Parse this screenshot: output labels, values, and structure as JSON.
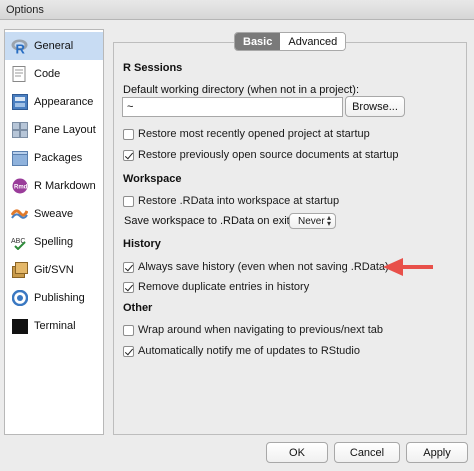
{
  "window": {
    "title": "Options"
  },
  "sidebar": {
    "items": [
      {
        "label": "General",
        "icon": "r-logo-icon",
        "selected": true
      },
      {
        "label": "Code",
        "icon": "code-icon"
      },
      {
        "label": "Appearance",
        "icon": "appearance-icon"
      },
      {
        "label": "Pane Layout",
        "icon": "pane-layout-icon"
      },
      {
        "label": "Packages",
        "icon": "packages-icon"
      },
      {
        "label": "R Markdown",
        "icon": "rmd-icon"
      },
      {
        "label": "Sweave",
        "icon": "sweave-icon"
      },
      {
        "label": "Spelling",
        "icon": "spelling-icon"
      },
      {
        "label": "Git/SVN",
        "icon": "git-svn-icon"
      },
      {
        "label": "Publishing",
        "icon": "publishing-icon"
      },
      {
        "label": "Terminal",
        "icon": "terminal-icon"
      }
    ]
  },
  "tabs": {
    "basic": "Basic",
    "advanced": "Advanced",
    "active": "Basic"
  },
  "sessions": {
    "title": "R Sessions",
    "wd_label": "Default working directory (when not in a project):",
    "wd_value": "~",
    "browse_label": "Browse...",
    "restore_project": "Restore most recently opened project at startup",
    "restore_docs": "Restore previously open source documents at startup"
  },
  "workspace": {
    "title": "Workspace",
    "restore_rdata": "Restore .RData into workspace at startup",
    "save_label": "Save workspace to .RData on exit:",
    "save_value": "Never"
  },
  "history": {
    "title": "History",
    "always_save": "Always save history (even when not saving .RData)",
    "remove_dups": "Remove duplicate entries in history"
  },
  "other": {
    "title": "Other",
    "wrap_around": "Wrap around when navigating to previous/next tab",
    "notify_updates": "Automatically notify me of updates to RStudio"
  },
  "checks": {
    "restore_project": false,
    "restore_docs": true,
    "restore_rdata": false,
    "always_save": true,
    "remove_dups": true,
    "wrap_around": false,
    "notify_updates": true
  },
  "footer": {
    "ok": "OK",
    "cancel": "Cancel",
    "apply": "Apply"
  },
  "colors": {
    "annotation_arrow": "#e8504a",
    "selection": "#c8dcf3"
  }
}
